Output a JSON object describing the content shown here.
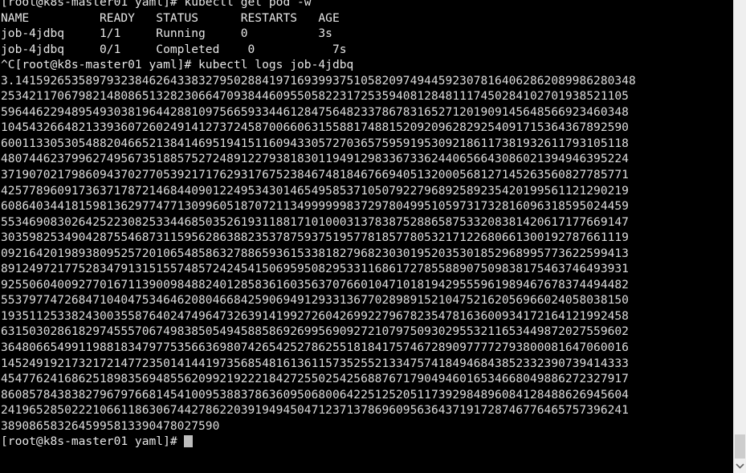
{
  "terminal": {
    "host_prompt": "[root@k8s-master01 yaml]# ",
    "background_color": "#000000",
    "foreground_color": "#d8d8d8",
    "cursor_color": "#bdbdbd",
    "lines": [
      {
        "type": "command",
        "text": "[root@k8s-master01 yaml]# kubectl get pod -w"
      },
      {
        "type": "table-header",
        "text": "NAME          READY   STATUS      RESTARTS   AGE"
      },
      {
        "type": "table-row",
        "text": "job-4jdbq     1/1     Running     0          3s"
      },
      {
        "type": "table-row",
        "text": "job-4jdbq     0/1     Completed    0           7s"
      },
      {
        "type": "command",
        "text": "^C[root@k8s-master01 yaml]# kubectl logs job-4jdbq"
      },
      {
        "type": "output",
        "text": "3.1415926535897932384626433832795028841971693993751058209749445923078164062862089986280348"
      },
      {
        "type": "output",
        "text": "25342117067982148086513282306647093844609550582231725359408128481117450284102701938521105"
      },
      {
        "type": "output",
        "text": "59644622948954930381964428810975665933446128475648233786783165271201909145648566923460348"
      },
      {
        "type": "output",
        "text": "10454326648213393607260249141273724587006606315588174881520920962829254091715364367892590"
      },
      {
        "type": "output",
        "text": "60011330530548820466521384146951941511609433057270365759591953092186117381932611793105118"
      },
      {
        "type": "output",
        "text": "48074462379962749567351885752724891227938183011949129833673362440656643086021394946395224"
      },
      {
        "type": "output",
        "text": "37190702179860943702770539217176293176752384674818467669405132000568127145263560827785771"
      },
      {
        "type": "output",
        "text": "42577896091736371787214684409012249534301465495853710507922796892589235420199561121290219"
      },
      {
        "type": "output",
        "text": "60864034418159813629774771309960518707211349999998372978049951059731732816096318595024459"
      },
      {
        "type": "output",
        "text": "55346908302642522308253344685035261931188171010003137838752886587533208381420617177669147"
      },
      {
        "type": "output",
        "text": "30359825349042875546873115956286388235378759375195778185778053217122680661300192787661119"
      },
      {
        "type": "output",
        "text": "09216420198938095257201065485863278865936153381827968230301952035301852968995773622599413"
      },
      {
        "type": "output",
        "text": "89124972177528347913151557485724245415069595082953311686172785588907509838175463746493931"
      },
      {
        "type": "output",
        "text": "92550604009277016711390098488240128583616035637076601047101819429555961989467678374494482"
      },
      {
        "type": "output",
        "text": "55379774726847104047534646208046684259069491293313677028989152104752162056966024058038150"
      },
      {
        "type": "output",
        "text": "19351125338243003558764024749647326391419927260426992279678235478163600934172164121992458"
      },
      {
        "type": "output",
        "text": "63150302861829745557067498385054945885869269956909272107975093029553211653449872027559602"
      },
      {
        "type": "output",
        "text": "36480665499119881834797753566369807426542527862551818417574672890977772793800081647060016"
      },
      {
        "type": "output",
        "text": "14524919217321721477235014144197356854816136115735255213347574184946843852332390739414333"
      },
      {
        "type": "output",
        "text": "45477624168625189835694855620992192221842725502542568876717904946016534668049886272327917"
      },
      {
        "type": "output",
        "text": "86085784383827967976681454100953883786360950680064225125205117392984896084128488626945604"
      },
      {
        "type": "output",
        "text": "24196528502221066118630674427862203919494504712371378696095636437191728746776465757396241"
      },
      {
        "type": "output",
        "text": "3890865832645995813390478027590"
      },
      {
        "type": "prompt",
        "text": "[root@k8s-master01 yaml]# ",
        "cursor": true
      }
    ]
  },
  "scrollbar": {
    "present": true,
    "position": "right",
    "track_color": "#efefef",
    "thumb_color": "#cdcdcd",
    "down_arrow_icon": "chevron-down-icon"
  }
}
